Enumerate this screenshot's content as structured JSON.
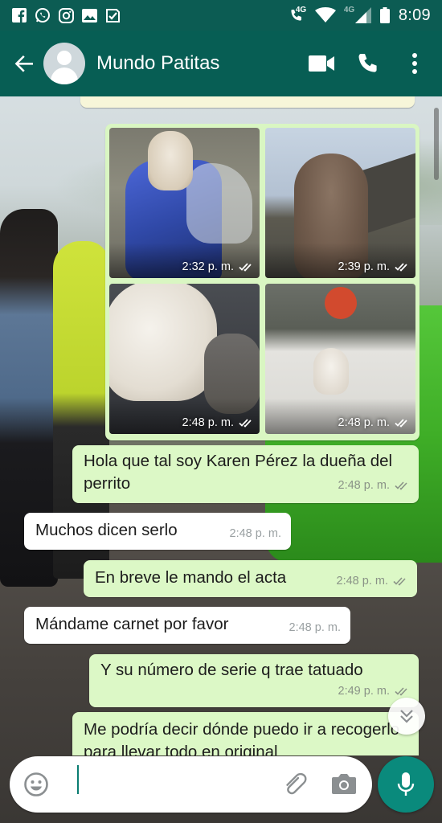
{
  "status_bar": {
    "time": "8:09",
    "network_label_1": "4G",
    "network_label_2": "4G",
    "icons": [
      "facebook-icon",
      "whatsapp-icon",
      "instagram-icon",
      "gallery-icon",
      "check-app-icon",
      "call-4g-icon",
      "wifi-icon",
      "signal-icon",
      "battery-icon"
    ]
  },
  "header": {
    "contact_name": "Mundo Patitas",
    "icons": [
      "back-arrow-icon",
      "avatar-placeholder-icon",
      "video-call-icon",
      "phone-icon",
      "more-vert-icon"
    ],
    "colors": {
      "header_bg": "#075e54",
      "status_bg": "#0c5c53"
    }
  },
  "media": {
    "photos": [
      {
        "time": "2:32 p. m."
      },
      {
        "time": "2:39 p. m."
      },
      {
        "time": "2:48 p. m."
      },
      {
        "time": "2:48 p. m."
      }
    ]
  },
  "messages": [
    {
      "direction": "out",
      "text": "Hola que tal soy Karen Pérez la dueña del perrito",
      "time": "2:48 p. m."
    },
    {
      "direction": "in",
      "text": "Muchos dicen serlo",
      "time": "2:48 p. m."
    },
    {
      "direction": "out",
      "text": "En breve le mando el acta",
      "time": "2:48 p. m."
    },
    {
      "direction": "in",
      "text": "Mándame carnet por favor",
      "time": "2:48 p. m."
    },
    {
      "direction": "out",
      "text": "Y su número de serie q trae tatuado",
      "time": "2:49 p. m."
    },
    {
      "direction": "out",
      "text": "Me podría decir dónde puedo ir a recogerlo para llevar todo en original",
      "time": ""
    }
  ],
  "input": {
    "value": "",
    "icons": [
      "emoji-icon",
      "attach-icon",
      "camera-icon",
      "mic-icon"
    ]
  },
  "colors": {
    "outgoing_bubble": "#dcf8c6",
    "incoming_bubble": "#ffffff",
    "accent": "#0a8a7c"
  }
}
